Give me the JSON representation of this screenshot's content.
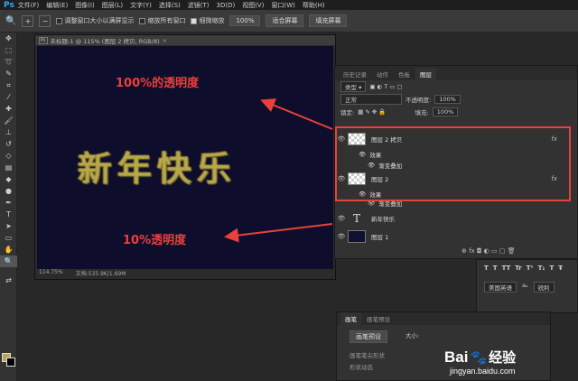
{
  "menubar": {
    "logo": "Ps",
    "items": [
      "文件(F)",
      "编辑(E)",
      "图像(I)",
      "图层(L)",
      "文字(Y)",
      "选择(S)",
      "滤镜(T)",
      "3D(D)",
      "视图(V)",
      "窗口(W)",
      "帮助(H)"
    ]
  },
  "options": {
    "chk1": "调整窗口大小以满屏显示",
    "chk2": "缩放所有窗口",
    "chk3": "细微缩放",
    "zoom_btn": "100%",
    "fit_btn": "适合屏幕",
    "fill_btn": "填充屏幕"
  },
  "document": {
    "tab_title": "未标题-1 @ 115% (图层 2 拷贝, RGB/8)",
    "art_text": "新年快乐",
    "annotation_top": "100%的透明度",
    "annotation_bottom": "10%透明度",
    "status_zoom": "114.75%",
    "status_doc": "文档:535.9K/1.69M"
  },
  "layers_panel": {
    "tabs": [
      "历史记录",
      "动作",
      "色板",
      "图层"
    ],
    "kind_label": "类型",
    "blend_mode": "正常",
    "opacity_label": "不透明度:",
    "opacity_value": "100%",
    "lock_label": "锁定:",
    "fill_label": "填充:",
    "fill_value": "100%",
    "layers": [
      {
        "name": "图层 2 拷贝",
        "fx": "fx"
      },
      {
        "name": "效果"
      },
      {
        "name": "渐变叠加"
      },
      {
        "name": "图层 2",
        "fx": "fx"
      },
      {
        "name": "效果"
      },
      {
        "name": "渐变叠加"
      },
      {
        "name": "新年快乐"
      },
      {
        "name": "图层 1"
      }
    ],
    "bottom_icons": "⊕ fx ◘ ◐ ▭ ▢ 🗑"
  },
  "char_panel": {
    "buttons": [
      "T",
      "T",
      "TT",
      "Tr",
      "T¹",
      "T₁",
      "T",
      "Ŧ"
    ],
    "lang": "美国英语",
    "aa": "锐利"
  },
  "brush_panel": {
    "tabs": [
      "画笔",
      "画笔预设"
    ],
    "preset_btn": "画笔预设",
    "size_label": "大小:",
    "tip_label": "画笔笔尖形状",
    "shape_label": "形状动态"
  },
  "watermark": {
    "brand": "Bai",
    "brand2": "经验",
    "url": "jingyan.baidu.com"
  },
  "colors": {
    "accent": "#e8413a",
    "canvas": "#0e0e2c",
    "art": "#b8a84a"
  }
}
